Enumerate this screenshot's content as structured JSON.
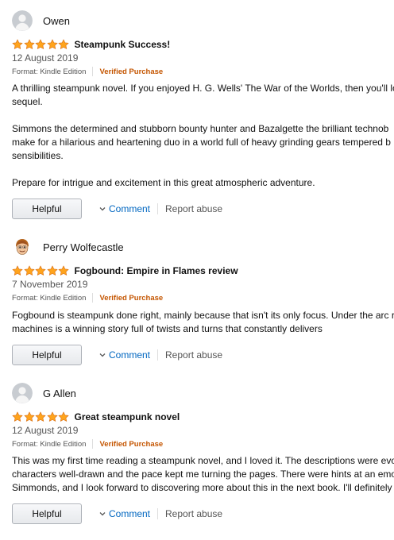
{
  "colors": {
    "star": "#ffa41c",
    "star_outline": "#de7921",
    "verified": "#c45500",
    "link": "#0066c0"
  },
  "reviews": [
    {
      "author": "Owen",
      "avatar": "default-avatar-icon",
      "rating": 5,
      "title": "Steampunk Success!",
      "date": "12 August 2019",
      "format": "Format: Kindle Edition",
      "verified": "Verified Purchase",
      "body": [
        "A thrilling steampunk novel. If you enjoyed H. G. Wells' The War of the Worlds, then you'll lo",
        "sequel.",
        "",
        "Simmons the determined and stubborn bounty hunter and Bazalgette the brilliant technob",
        "make for a hilarious and heartening duo in a world full of heavy grinding gears tempered b",
        "sensibilities.",
        "",
        "Prepare for intrigue and excitement in this great atmospheric adventure."
      ],
      "helpful": "Helpful",
      "comment": "Comment",
      "report": "Report abuse"
    },
    {
      "author": "Perry Wolfecastle",
      "avatar": "cartoon-face-avatar-icon",
      "rating": 5,
      "title": "Fogbound: Empire in Flames review",
      "date": "7 November 2019",
      "format": "Format: Kindle Edition",
      "verified": "Verified Purchase",
      "body": [
        "Fogbound is steampunk done right, mainly because that isn't its only focus. Under the arc r",
        "machines is a winning story full of twists and turns that constantly delivers"
      ],
      "helpful": "Helpful",
      "comment": "Comment",
      "report": "Report abuse"
    },
    {
      "author": "G Allen",
      "avatar": "default-avatar-icon",
      "rating": 5,
      "title": "Great steampunk novel",
      "date": "12 August 2019",
      "format": "Format: Kindle Edition",
      "verified": "Verified Purchase",
      "body": [
        "This was my first time reading a steampunk novel, and I loved it. The descriptions were evoc",
        "characters well-drawn and the pace kept me turning the pages. There were hints at an emo",
        "Simmonds, and I look forward to discovering more about this in the next book. I'll definitely"
      ],
      "helpful": "Helpful",
      "comment": "Comment",
      "report": "Report abuse"
    }
  ]
}
